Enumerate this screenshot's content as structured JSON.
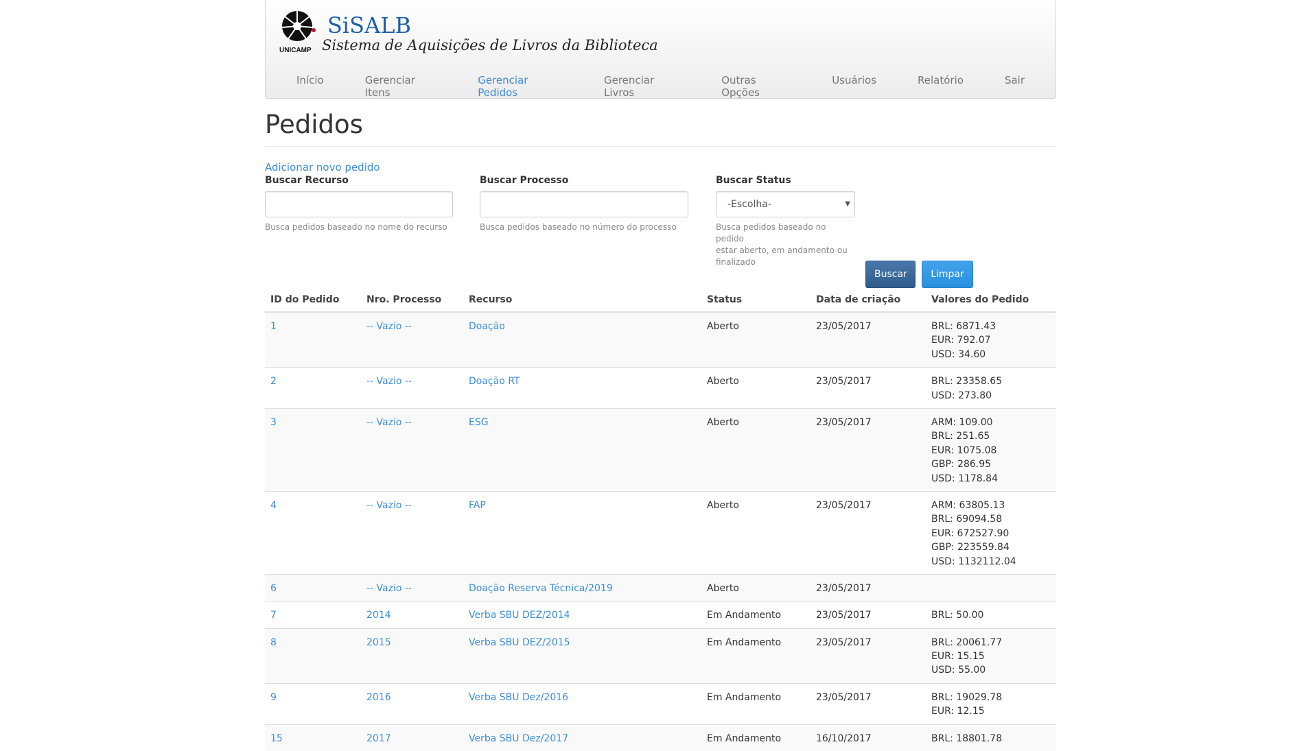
{
  "header": {
    "logo_text": "UNICAMP",
    "brand": "SiSALB",
    "subtitle": "Sistema de Aquisições de Livros da Biblioteca"
  },
  "nav": [
    "Início",
    "Gerenciar Itens",
    "Gerenciar Pedidos",
    "Gerenciar Livros",
    "Outras Opções",
    "Usuários",
    "Relatório",
    "Sair"
  ],
  "nav_active_index": 2,
  "page_title": "Pedidos",
  "add_link": "Adicionar novo pedido",
  "search": {
    "recurso": {
      "label": "Buscar Recurso",
      "value": "",
      "help": "Busca pedidos baseado no nome do recurso"
    },
    "processo": {
      "label": "Buscar Processo",
      "value": "",
      "help": "Busca pedidos baseado no número do processo"
    },
    "status": {
      "label": "Buscar Status",
      "selected": "-Escolha-",
      "help_lines": [
        "Busca pedidos baseado no pedido",
        "estar aberto, em andamento ou",
        "finalizado"
      ]
    },
    "buscar_button": "Buscar",
    "limpar_button": "Limpar"
  },
  "table": {
    "headers": [
      "ID do Pedido",
      "Nro. Processo",
      "Recurso",
      "Status",
      "Data de criação",
      "Valores do Pedido"
    ],
    "rows": [
      {
        "id": "1",
        "processo": "-- Vazio --",
        "recurso": "Doação",
        "status": "Aberto",
        "data": "23/05/2017",
        "valores": [
          "BRL: 6871.43",
          "EUR: 792.07",
          "USD: 34.60"
        ]
      },
      {
        "id": "2",
        "processo": "-- Vazio --",
        "recurso": "Doação RT",
        "status": "Aberto",
        "data": "23/05/2017",
        "valores": [
          "BRL: 23358.65",
          "USD: 273.80"
        ]
      },
      {
        "id": "3",
        "processo": "-- Vazio --",
        "recurso": "ESG",
        "status": "Aberto",
        "data": "23/05/2017",
        "valores": [
          "ARM: 109.00",
          "BRL: 251.65",
          "EUR: 1075.08",
          "GBP: 286.95",
          "USD: 1178.84"
        ]
      },
      {
        "id": "4",
        "processo": "-- Vazio --",
        "recurso": "FAP",
        "status": "Aberto",
        "data": "23/05/2017",
        "valores": [
          "ARM: 63805.13",
          "BRL: 69094.58",
          "EUR: 672527.90",
          "GBP: 223559.84",
          "USD: 1132112.04"
        ]
      },
      {
        "id": "6",
        "processo": "-- Vazio --",
        "recurso": "Doação Reserva Técnica/2019",
        "status": "Aberto",
        "data": "23/05/2017",
        "valores": []
      },
      {
        "id": "7",
        "processo": "2014",
        "recurso": "Verba SBU DEZ/2014",
        "status": "Em Andamento",
        "data": "23/05/2017",
        "valores": [
          "BRL: 50.00"
        ]
      },
      {
        "id": "8",
        "processo": "2015",
        "recurso": "Verba SBU DEZ/2015",
        "status": "Em Andamento",
        "data": "23/05/2017",
        "valores": [
          "BRL: 20061.77",
          "EUR: 15.15",
          "USD: 55.00"
        ]
      },
      {
        "id": "9",
        "processo": "2016",
        "recurso": "Verba SBU Dez/2016",
        "status": "Em Andamento",
        "data": "23/05/2017",
        "valores": [
          "BRL: 19029.78",
          "EUR: 12.15"
        ]
      },
      {
        "id": "15",
        "processo": "2017",
        "recurso": "Verba SBU Dez/2017",
        "status": "Em Andamento",
        "data": "16/10/2017",
        "valores": [
          "BRL: 18801.78"
        ]
      }
    ]
  }
}
